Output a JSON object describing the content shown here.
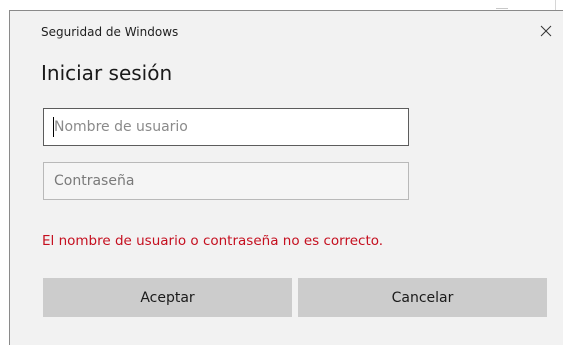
{
  "dialog": {
    "title": "Seguridad de Windows",
    "heading": "Iniciar sesión",
    "close_icon": "close-icon"
  },
  "form": {
    "username": {
      "value": "",
      "placeholder": "Nombre de usuario"
    },
    "password": {
      "value": "",
      "placeholder": "Contraseña"
    }
  },
  "error": {
    "message": "El nombre de usuario o contraseña no es correcto.",
    "color": "#c50f1f"
  },
  "buttons": {
    "ok_label": "Aceptar",
    "cancel_label": "Cancelar"
  }
}
